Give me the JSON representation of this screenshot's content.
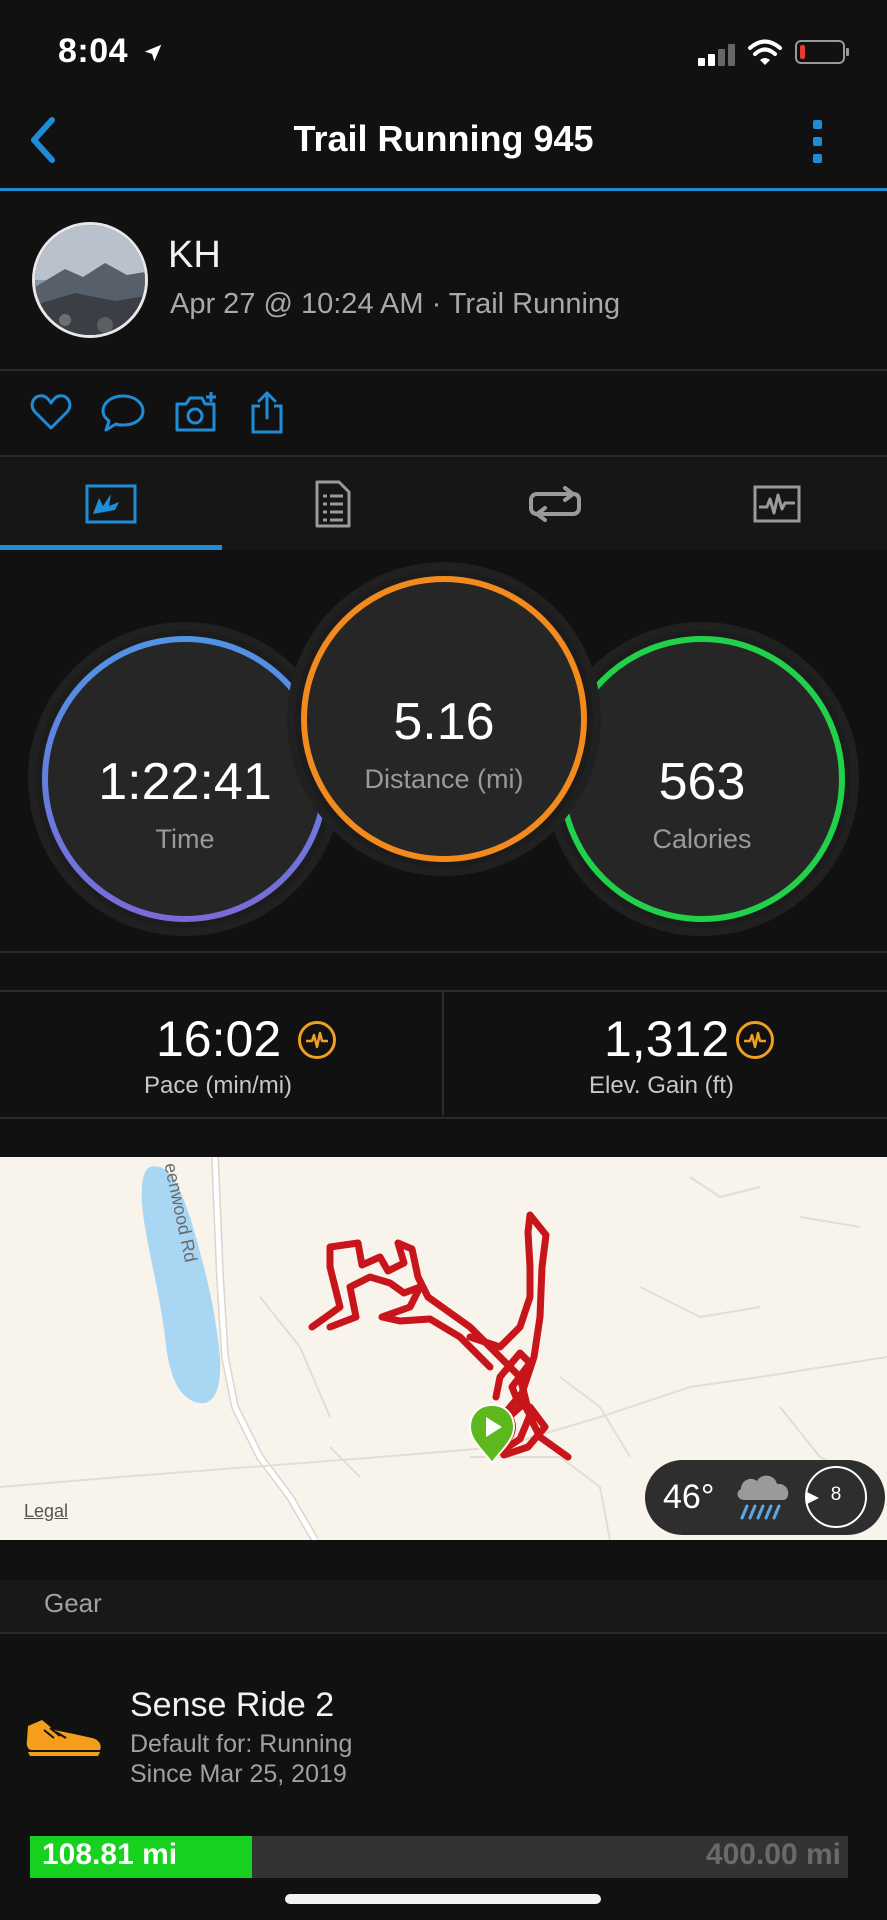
{
  "status_bar": {
    "time": "8:04"
  },
  "nav": {
    "title": "Trail Running 945",
    "back_icon": "chevron-left-icon",
    "menu_icon": "kebab-menu-icon"
  },
  "profile": {
    "name": "KH",
    "meta": "Apr 27 @ 10:24 AM · Trail Running"
  },
  "actions": [
    "heart-icon",
    "comment-icon",
    "add-photo-icon",
    "share-icon"
  ],
  "tabs": [
    {
      "icon": "summary-icon",
      "active": true
    },
    {
      "icon": "details-icon",
      "active": false
    },
    {
      "icon": "laps-icon",
      "active": false
    },
    {
      "icon": "charts-icon",
      "active": false
    }
  ],
  "summary": {
    "time": {
      "value": "1:22:41",
      "label": "Time"
    },
    "distance": {
      "value": "5.16",
      "label": "Distance (mi)"
    },
    "calories": {
      "value": "563",
      "label": "Calories"
    }
  },
  "stats": {
    "pace": {
      "value": "16:02",
      "label": "Pace (min/mi)"
    },
    "elevation": {
      "value": "1,312",
      "label": "Elev. Gain (ft)"
    }
  },
  "map": {
    "road_label": "eenwood Rd",
    "legal": "Legal",
    "weather": {
      "temp": "46°",
      "wind": "8"
    }
  },
  "gear": {
    "header": "Gear",
    "name": "Sense Ride 2",
    "default_for": "Default for: Running",
    "since": "Since Mar 25, 2019",
    "used": "108.81 mi",
    "total": "400.00 mi",
    "used_fraction": 0.272
  },
  "colors": {
    "accent": "#1f8dd6",
    "time_ring": "#5b8fe0",
    "distance_ring": "#f28a1d",
    "calories_ring": "#22d14b",
    "route": "#c8141b",
    "gear_bar": "#17d11f"
  }
}
